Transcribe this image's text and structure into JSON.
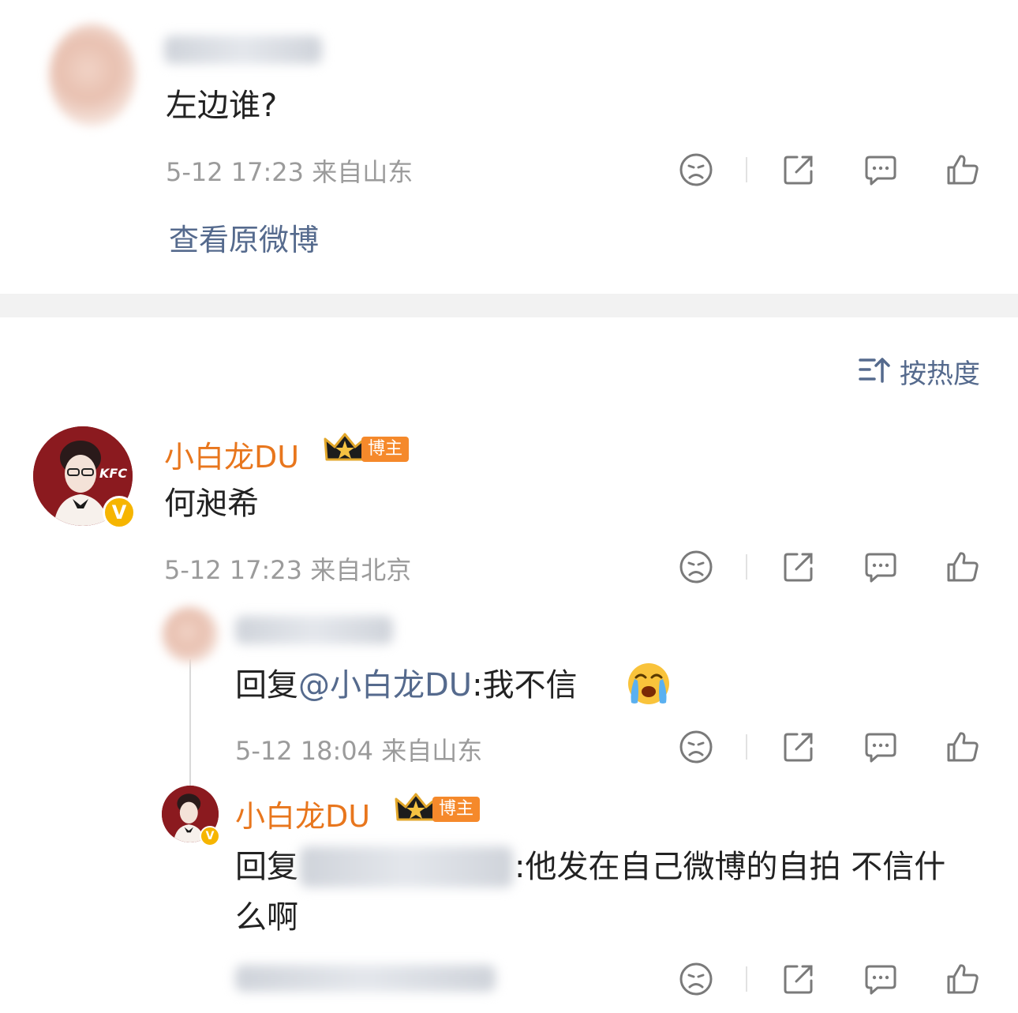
{
  "comment1": {
    "text": "左边谁?",
    "meta": "5-12 17:23  来自山东",
    "view_original": "查看原微博"
  },
  "sort": {
    "label": "按热度"
  },
  "comment2": {
    "username": "小白龙DU",
    "badge": "博主",
    "text": "何昶希",
    "meta": "5-12 17:23  来自北京"
  },
  "reply1": {
    "prefix": "回复",
    "mention": "@小白龙DU",
    "text": ":我不信",
    "meta": "5-12 18:04  来自山东"
  },
  "reply2": {
    "username": "小白龙DU",
    "badge": "博主",
    "prefix": "回复",
    "text_line1": ":他发在自己微博的自拍 不信什",
    "text_line2": "么啊"
  },
  "avatar_text": "KFC",
  "verified_mark": "V",
  "colors": {
    "link": "#556a8d",
    "username": "#e8761d",
    "badge": "#f5892b",
    "meta": "#9b9b9b"
  },
  "icons": [
    "sad-face-icon",
    "share-icon",
    "comment-icon",
    "like-icon",
    "sort-icon",
    "crown-icon",
    "crying-emoji-icon"
  ]
}
